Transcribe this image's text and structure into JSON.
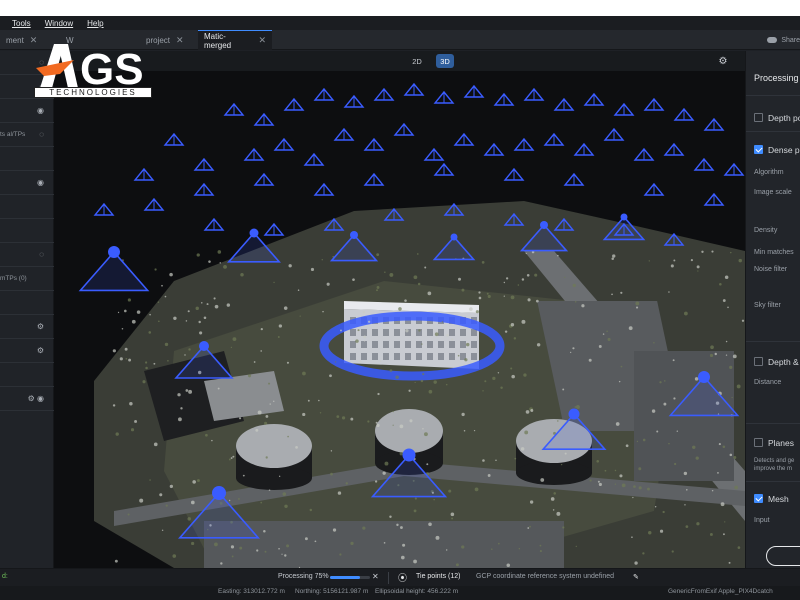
{
  "menu": [
    "Tools",
    "Window",
    "Help"
  ],
  "tabs": [
    {
      "label": "ment",
      "active": false
    },
    {
      "label": "W",
      "active": false
    },
    {
      "label": "project",
      "active": false
    },
    {
      "label": "Matic-merged",
      "active": true
    }
  ],
  "share_label": "Share",
  "logo": {
    "brand": "AGS",
    "tagline": "TECHNOLOGIES"
  },
  "viewport": {
    "mode_2d": "2D",
    "mode_3d": "3D",
    "active_mode": "3D"
  },
  "left_panel": {
    "rows": [
      {
        "text": "",
        "icon": "eye-off-icon"
      },
      {
        "text": "",
        "icon": "eye-off-icon"
      },
      {
        "text": "",
        "icon": "eye-icon"
      },
      {
        "text": "ts al/TPs",
        "icon": "eye-off-icon"
      },
      {
        "text": "",
        "icon": ""
      },
      {
        "text": "",
        "icon": "eye-icon"
      },
      {
        "text": "",
        "icon": ""
      },
      {
        "text": "",
        "icon": ""
      },
      {
        "text": "",
        "icon": "eye-off-icon"
      },
      {
        "text": "mTPs (0)",
        "icon": ""
      },
      {
        "text": "",
        "icon": ""
      },
      {
        "text": "",
        "icon": "gear-icon"
      },
      {
        "text": "",
        "icon": "gear-icon"
      },
      {
        "text": "",
        "icon": ""
      },
      {
        "text": "",
        "icon": "gear-eye-icon"
      }
    ]
  },
  "right_panel": {
    "title": "Processing",
    "depth_points": "Depth po",
    "dense_points": "Dense po",
    "algorithm": "Algorithm",
    "image_scale": "Image scale",
    "density": "Density",
    "min_matches": "Min matches",
    "noise_filter": "Noise filter",
    "sky_filter": "Sky filter",
    "depth_and": "Depth &",
    "distance": "Distance",
    "planes": "Planes",
    "planes_desc_1": "Detects and ge",
    "planes_desc_2": "improve the m",
    "mesh": "Mesh",
    "input": "Input"
  },
  "status": {
    "left_text": "d:",
    "processing_label": "Processing 75%",
    "progress": 0.75,
    "tie_points": "Tie points (12)",
    "gcp_text": "GCP coordinate reference system undefined"
  },
  "bottom": {
    "easting": "Easting: 313012.772 m",
    "northing": "Northing: 5156121.987 m",
    "ellipsoidal": "Ellipsoidal height: 456.222 m",
    "camera": "GenericFromExif Apple_PIX4Dcatch"
  },
  "colors": {
    "accent": "#3f8cff",
    "camera_blue": "#3a5cff",
    "logo_orange": "#f26a21"
  }
}
